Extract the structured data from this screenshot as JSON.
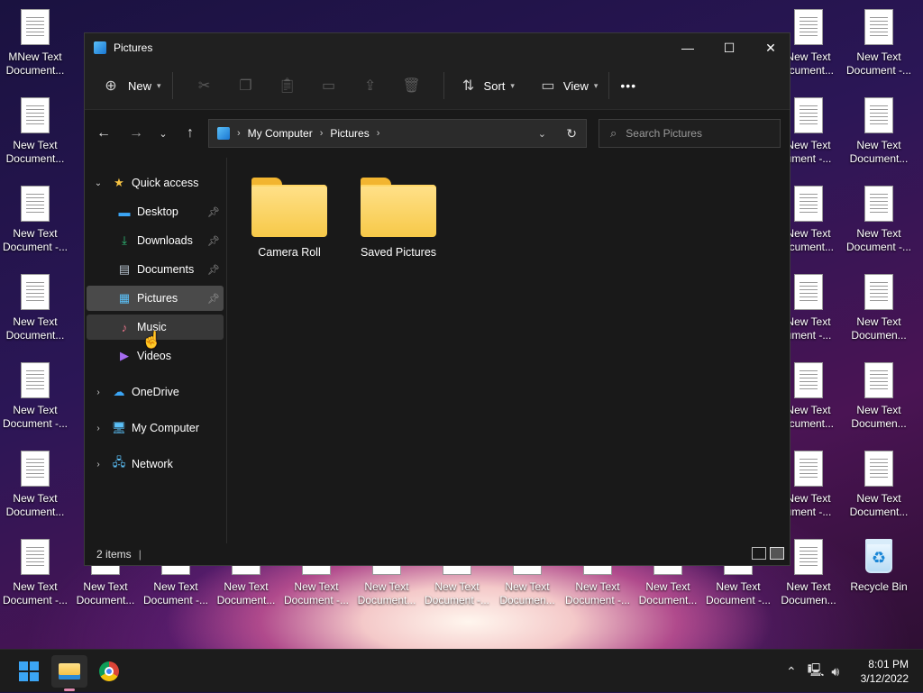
{
  "desktop": {
    "left_col_labels": [
      [
        "MNew Text",
        "Document..."
      ],
      [
        "New Text",
        "Document..."
      ],
      [
        "New Text",
        "Document -..."
      ],
      [
        "New Text",
        "Document..."
      ],
      [
        "New Text",
        "Document -..."
      ],
      [
        "New Text",
        "Document..."
      ],
      [
        "New Text",
        "Document -..."
      ]
    ],
    "bottom_row_labels": [
      [
        "New Text",
        "Document..."
      ],
      [
        "New Text",
        "Document -..."
      ],
      [
        "New Text",
        "Document..."
      ],
      [
        "New Text",
        "Document -..."
      ],
      [
        "New Text",
        "Document..."
      ],
      [
        "New Text",
        "Document -..."
      ],
      [
        "New Text",
        "Documen..."
      ],
      [
        "New Text",
        "Document -..."
      ],
      [
        "New Text",
        "Document..."
      ],
      [
        "New Text",
        "Document -..."
      ]
    ],
    "right_col_a_labels": [
      [
        "New Text",
        "ocument..."
      ],
      [
        "New Text",
        "ument -..."
      ],
      [
        "New Text",
        "ocument..."
      ],
      [
        "New Text",
        "ument -..."
      ],
      [
        "New Text",
        "ocument..."
      ],
      [
        "New Text",
        "ument -..."
      ],
      [
        "New Text",
        "Documen..."
      ]
    ],
    "right_col_b_labels": [
      [
        "New Text",
        "Document -..."
      ],
      [
        "New Text",
        "Document..."
      ],
      [
        "New Text",
        "Document -..."
      ],
      [
        "New Text",
        "Documen..."
      ],
      [
        "New Text",
        "Documen..."
      ],
      [
        "New Text",
        "Document..."
      ]
    ],
    "recycle_bin": "Recycle Bin"
  },
  "window": {
    "title": "Pictures",
    "controls": {
      "minimize": "—",
      "maximize": "☐",
      "close": "✕"
    }
  },
  "toolbar": {
    "new_label": "New",
    "sort_label": "Sort",
    "view_label": "View",
    "more_label": "•••"
  },
  "address": {
    "crumbs": [
      "My Computer",
      "Pictures"
    ],
    "search_placeholder": "Search Pictures"
  },
  "nav": {
    "quick_access": "Quick access",
    "items": [
      {
        "label": "Desktop",
        "icon": "desktop-icon",
        "pinned": true
      },
      {
        "label": "Downloads",
        "icon": "download-icon",
        "pinned": true
      },
      {
        "label": "Documents",
        "icon": "documents-icon",
        "pinned": true
      },
      {
        "label": "Pictures",
        "icon": "pictures-icon",
        "pinned": true,
        "selected": true
      },
      {
        "label": "Music",
        "icon": "music-icon",
        "hovered": true
      },
      {
        "label": "Videos",
        "icon": "videos-icon"
      }
    ],
    "onedrive": "OneDrive",
    "my_computer": "My Computer",
    "network": "Network"
  },
  "content": {
    "folders": [
      {
        "name": "Camera Roll"
      },
      {
        "name": "Saved Pictures"
      }
    ]
  },
  "status": {
    "items_count": "2 items"
  },
  "taskbar": {
    "time": "8:01 PM",
    "date": "3/12/2022"
  },
  "colors": {
    "accent": "#3ba5f5",
    "folder": "#f7c948",
    "window_bg": "#191919"
  }
}
